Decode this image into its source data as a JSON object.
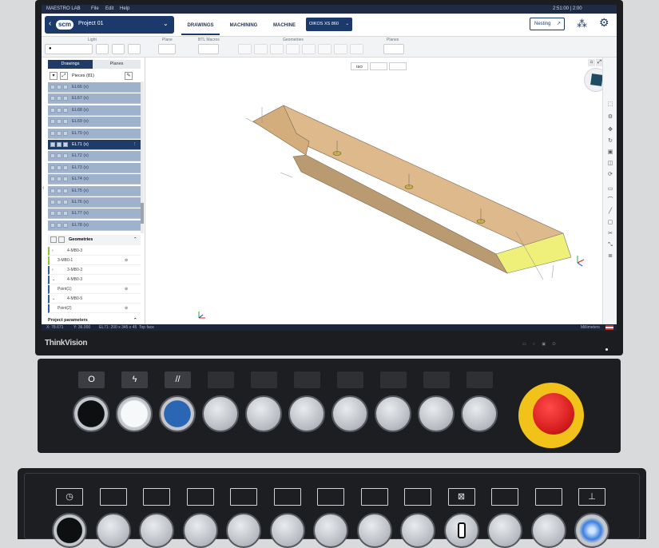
{
  "system_bar": {
    "app": "MAESTRO LAB",
    "menus": [
      "File",
      "Edit",
      "Help"
    ],
    "clock": "2:51:00 | 2:00"
  },
  "header": {
    "brand": "scm",
    "project_title": "Project 01",
    "tabs": [
      "DRAWINGS",
      "MACHINING",
      "MACHINE"
    ],
    "machine_select": "OIKOS XS 860",
    "nesting_label": "Nesting"
  },
  "toolbar": {
    "groups": [
      "Light",
      "Plane",
      "BTL Macros",
      "Geometries",
      "Planes"
    ]
  },
  "sidebar": {
    "tabs": [
      "Drawings",
      "Planes"
    ],
    "pieces_header": "Pieces (81)",
    "pieces": [
      "EL66 (x)",
      "EL67 (x)",
      "EL68 (x)",
      "EL69 (x)",
      "EL70 (x)",
      "EL71 (x)",
      "EL72 (x)",
      "EL73 (x)",
      "EL74 (x)",
      "EL75 (x)",
      "EL76 (x)",
      "EL77 (x)",
      "EL78 (x)"
    ],
    "selected_index": 5,
    "geometries_header": "Geometries",
    "geometries": [
      "4-MB0-3",
      "3-MB0-1",
      "3-MB0-2",
      "4-MB0-3",
      "Point(1)",
      "4-MB0-5",
      "Point(2)"
    ],
    "project_params": "Project parameters"
  },
  "canvas": {
    "view_selects": [
      "ISO",
      "",
      ""
    ]
  },
  "status_bar": {
    "left": [
      "X: 78.671",
      "Y: 36.000",
      "EL71: 200 x 345 x 45",
      "Top face"
    ],
    "right": "Millimeters"
  },
  "monitor": {
    "brand": "ThinkVision"
  },
  "panel1": {
    "labels": [
      "O",
      "ϟ",
      "//",
      "",
      "",
      "",
      "",
      "",
      "",
      ""
    ]
  },
  "panel2": {
    "labels": [
      "◷",
      "",
      "",
      "",
      "",
      "",
      "",
      "",
      "",
      "⊠",
      "",
      "",
      "⊥"
    ]
  },
  "colors": {
    "navy": "#1b3a6b",
    "wood": "#dcb98a",
    "end_face": "#eef07a",
    "emergency": "#d81f1f"
  }
}
